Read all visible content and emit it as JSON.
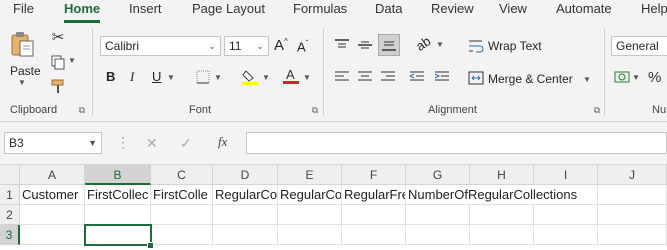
{
  "tabs": [
    "File",
    "Home",
    "Insert",
    "Page Layout",
    "Formulas",
    "Data",
    "Review",
    "View",
    "Automate",
    "Help"
  ],
  "active_tab": "Home",
  "accent": "#1e6b3c",
  "clipboard": {
    "paste_label": "Paste",
    "group_label": "Clipboard"
  },
  "font": {
    "name": "Calibri",
    "size": "11",
    "group_label": "Font"
  },
  "alignment": {
    "wrap_text": "Wrap Text",
    "merge_center": "Merge & Center",
    "group_label": "Alignment"
  },
  "number": {
    "format": "General",
    "group_label": "Nu"
  },
  "name_box": "B3",
  "fx_label": "fx",
  "columns": [
    "A",
    "B",
    "C",
    "D",
    "E",
    "F",
    "G",
    "H",
    "I",
    "J"
  ],
  "rows": [
    "1",
    "2",
    "3"
  ],
  "row1": [
    "Customer",
    "FirstCollec",
    "FirstColle",
    "RegularCo",
    "RegularCo",
    "RegularFre",
    "NumberOfRegularCollections"
  ],
  "selected_cell": "B3"
}
